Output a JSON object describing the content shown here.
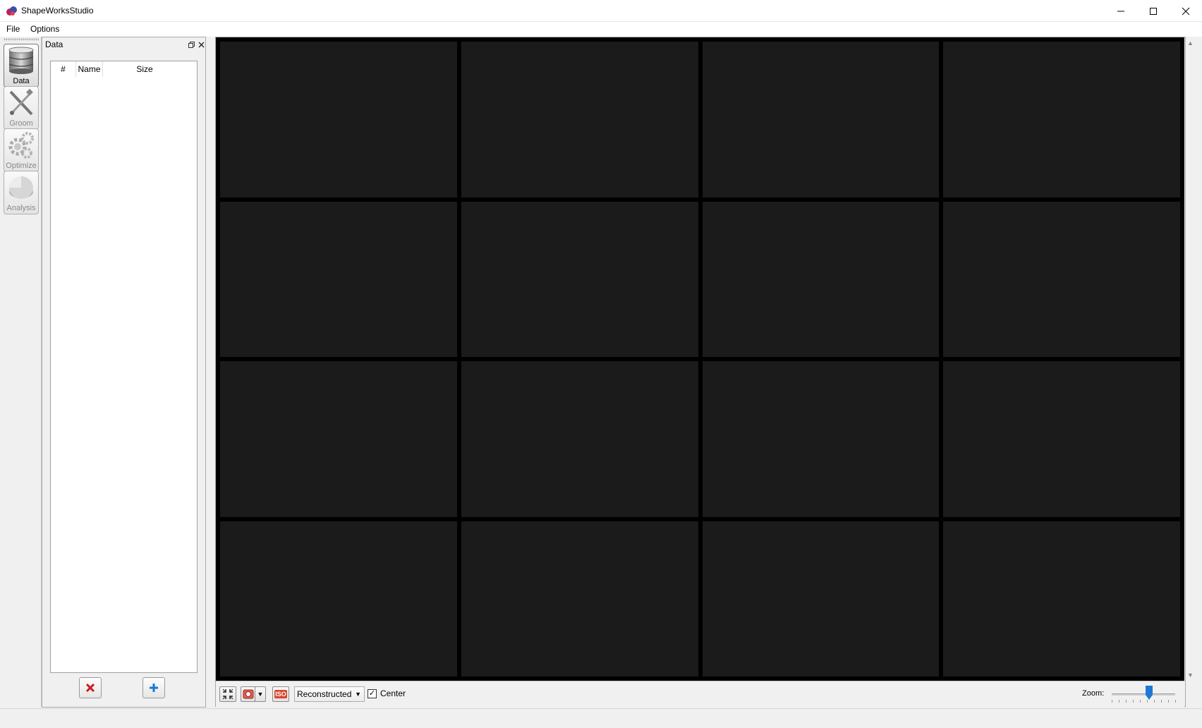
{
  "window": {
    "title": "ShapeWorksStudio",
    "icon": "shapeworks-logo-icon"
  },
  "menu": {
    "items": [
      "File",
      "Options"
    ]
  },
  "toolbar": {
    "items": [
      {
        "label": "Data",
        "icon": "database-icon",
        "active": true
      },
      {
        "label": "Groom",
        "icon": "groom-tools-icon",
        "active": false
      },
      {
        "label": "Optimize",
        "icon": "gears-icon",
        "active": false
      },
      {
        "label": "Analysis",
        "icon": "pie-chart-icon",
        "active": false
      }
    ]
  },
  "data_panel": {
    "title": "Data",
    "columns": [
      "#",
      "Name",
      "Size"
    ],
    "rows": [],
    "remove_button_icon": "red-x-icon",
    "add_button_icon": "blue-plus-icon"
  },
  "viewer": {
    "rows": 4,
    "cols": 4,
    "cell_color": "#1b1b1b"
  },
  "bottom_bar": {
    "display_mode": "Reconstructed",
    "center_label": "Center",
    "center_checked": true,
    "zoom_label": "Zoom:",
    "iso_label": "ISO"
  },
  "colors": {
    "accent": "#1e76d6",
    "danger": "#cc1e1e",
    "viewer_bg": "#000000"
  }
}
